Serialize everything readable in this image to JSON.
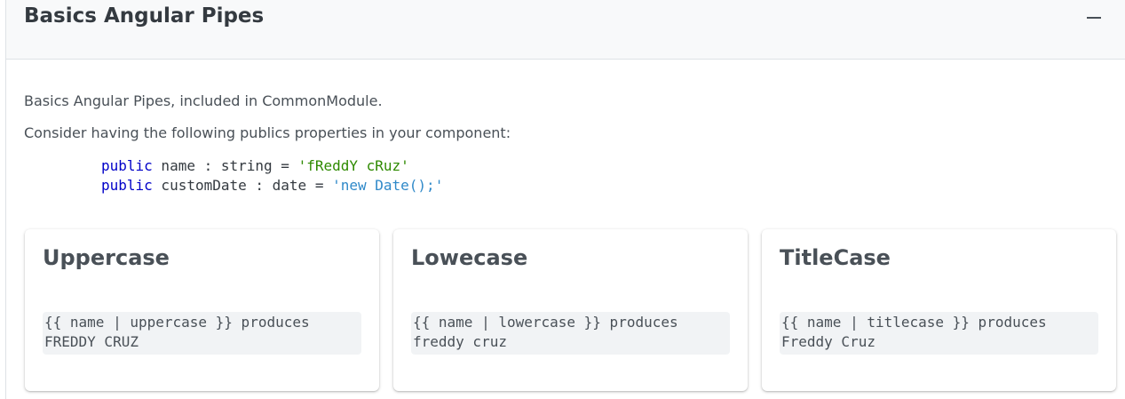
{
  "panel": {
    "title": "Basics Angular Pipes",
    "toggle_icon": "minus-icon"
  },
  "content": {
    "intro": "Basics Angular Pipes, included in CommonModule.",
    "consider": "Consider having the following publics properties in your component:",
    "code": [
      {
        "keyword": "public",
        "decl": " name : string = ",
        "value": "'fReddY cRuz'"
      },
      {
        "keyword": "public",
        "decl": " customDate : date = ",
        "value": "'new Date();'"
      }
    ]
  },
  "cards": [
    {
      "title": "Uppercase",
      "line1": "{{ name | uppercase }} produces",
      "line2": "FREDDY CRUZ"
    },
    {
      "title": "Lowecase",
      "line1": "{{ name | lowercase }} produces",
      "line2": "freddy cruz"
    },
    {
      "title": "TitleCase",
      "line1": "{{ name | titlecase }} produces",
      "line2": "Freddy Cruz"
    }
  ],
  "colors": {
    "keyword": "#0000c8",
    "string_green": "#2e8a00",
    "string_blue": "#2f89c9"
  }
}
